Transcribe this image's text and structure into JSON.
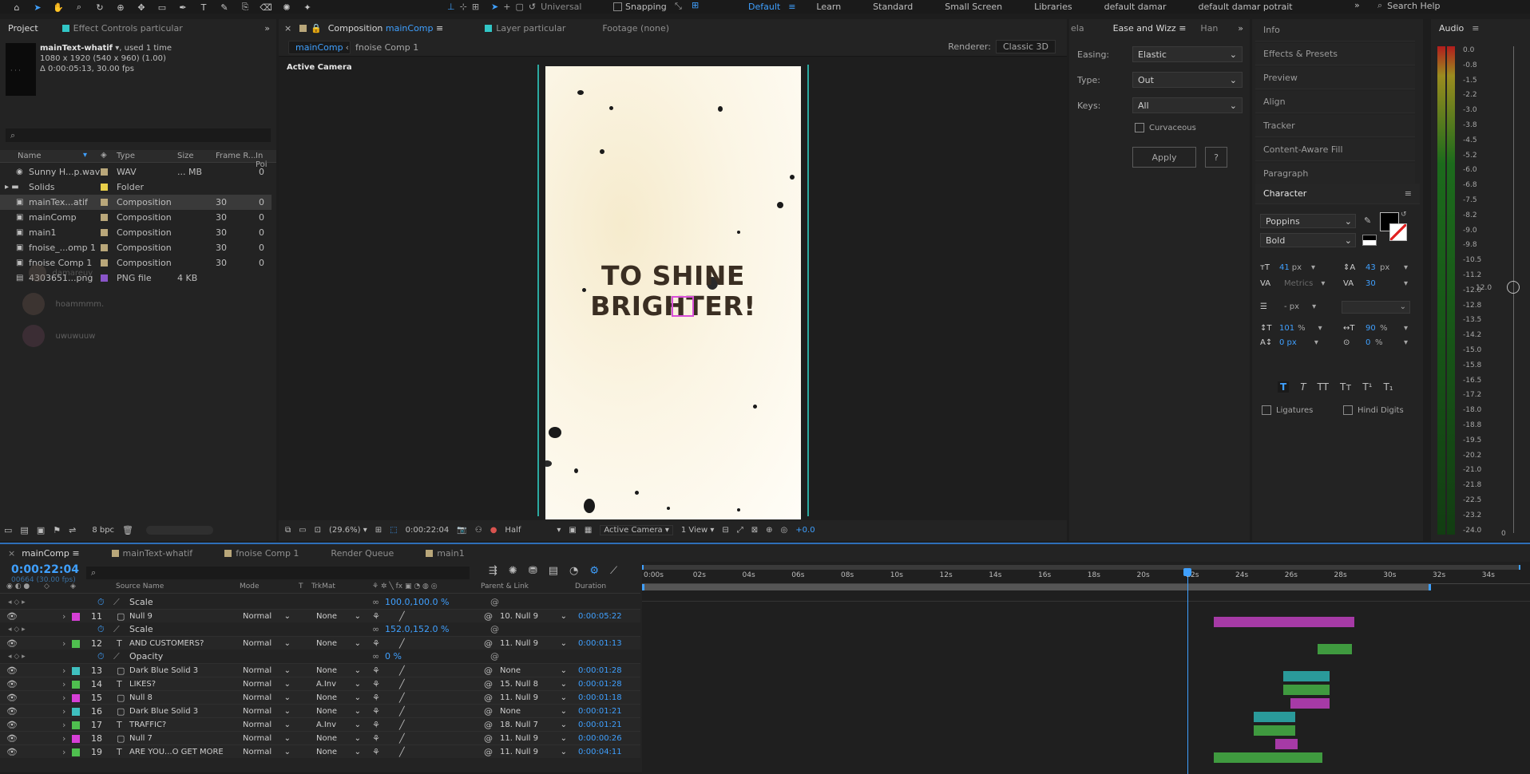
{
  "top": {
    "tools": [
      "home-icon",
      "selection-tool-icon",
      "hand-tool-icon",
      "zoom-tool-icon",
      "rotate-tool-icon",
      "camera-orbit-icon",
      "anchor-tool-icon",
      "rectangle-tool-icon",
      "pen-tool-icon",
      "type-tool-icon",
      "brush-tool-icon",
      "clone-tool-icon",
      "eraser-tool-icon",
      "roto-brush-icon",
      "puppet-tool-icon"
    ],
    "universal": "Universal",
    "snapping": "Snapping",
    "workspaces": [
      "Default",
      "Learn",
      "Standard",
      "Small Screen",
      "Libraries",
      "default damar",
      "default damar potrait"
    ],
    "search": "Search Help"
  },
  "project": {
    "tab": "Project",
    "effects_tab": "Effect Controls particular",
    "comp_name": "mainText-whatif",
    "used": ", used 1 time",
    "dims": "1080 x 1920  (540 x 960) (1.00)",
    "duration": "Δ 0:00:05:13, 30.00 fps",
    "cols": [
      "Name",
      "Type",
      "Size",
      "Frame R...",
      "In Poi"
    ],
    "items": [
      {
        "name": "Sunny H...p.wav",
        "type": "WAV",
        "size": "... MB",
        "fr": "",
        "inp": "0",
        "color": "#b9a77a"
      },
      {
        "name": "Solids",
        "type": "Folder",
        "size": "",
        "fr": "",
        "inp": "",
        "color": "#e8cf4a"
      },
      {
        "name": "mainTex...atif",
        "type": "Composition",
        "size": "",
        "fr": "30",
        "inp": "0",
        "color": "#b9a77a"
      },
      {
        "name": "mainComp",
        "type": "Composition",
        "size": "",
        "fr": "30",
        "inp": "0",
        "color": "#b9a77a"
      },
      {
        "name": "main1",
        "type": "Composition",
        "size": "",
        "fr": "30",
        "inp": "0",
        "color": "#b9a77a"
      },
      {
        "name": "fnoise_...omp 1",
        "type": "Composition",
        "size": "",
        "fr": "30",
        "inp": "0",
        "color": "#b9a77a"
      },
      {
        "name": "fnoise Comp 1",
        "type": "Composition",
        "size": "",
        "fr": "30",
        "inp": "0",
        "color": "#b9a77a"
      },
      {
        "name": "4303651...png",
        "type": "PNG file",
        "size": "4 KB",
        "fr": "",
        "inp": "",
        "color": "#8a55c9"
      }
    ],
    "ghosts": [
      "damareuy",
      "hoammmm.",
      "uwuwuuw"
    ],
    "bpc": "8 bpc"
  },
  "comp": {
    "tab": "Composition",
    "tab_name": "mainComp",
    "layer_tab": "Layer particular",
    "footage_tab": "Footage (none)",
    "crumbs": [
      "mainComp",
      "fnoise Comp 1"
    ],
    "renderer_label": "Renderer:",
    "renderer": "Classic 3D",
    "active_camera": "Active Camera",
    "text_line1": "TO SHINE",
    "text_line2": "BRIGHTER!",
    "zoom": "(29.6%)",
    "time": "0:00:22:04",
    "resolution": "Half",
    "camera": "Active Camera",
    "view": "1 View",
    "exposure": "+0.0"
  },
  "ease": {
    "tabs": [
      "ela",
      "Ease and Wizz",
      "Han"
    ],
    "easing_label": "Easing:",
    "easing": "Elastic",
    "type_label": "Type:",
    "type": "Out",
    "keys_label": "Keys:",
    "keys": "All",
    "curvaceous": "Curvaceous",
    "apply": "Apply",
    "help": "?"
  },
  "right": {
    "items": [
      "Info",
      "Effects & Presets",
      "Preview",
      "Align",
      "Tracker",
      "Content-Aware Fill",
      "Paragraph"
    ],
    "character": "Character",
    "font": "Poppins",
    "style": "Bold",
    "size": "41",
    "size_unit": "px",
    "leading": "43",
    "leading_unit": "px",
    "kerning": "Metrics",
    "tracking": "30",
    "stroke": "- px",
    "vscale": "101",
    "hscale": "90",
    "baseline": "0 px",
    "tsume": "0",
    "percent": "%",
    "ligatures": "Ligatures",
    "hindi": "Hindi Digits"
  },
  "audio": {
    "title": "Audio",
    "levels": [
      "0.0",
      "-0.8",
      "-1.5",
      "-2.2",
      "-3.0",
      "-3.8",
      "-4.5",
      "-5.2",
      "-6.0",
      "-6.8",
      "-7.5",
      "-8.2",
      "-9.0",
      "-9.8",
      "-10.5",
      "-11.2",
      "-12.0",
      "-12.8",
      "-13.5",
      "-14.2",
      "-15.0",
      "-15.8",
      "-16.5",
      "-17.2",
      "-18.0",
      "-18.8",
      "-19.5",
      "-20.2",
      "-21.0",
      "-21.8",
      "-22.5",
      "-23.2",
      "-24.0"
    ],
    "right": [
      "12.0",
      "0"
    ]
  },
  "timeline": {
    "tabs": [
      "mainComp",
      "mainText-whatif",
      "fnoise Comp 1",
      "Render Queue",
      "main1"
    ],
    "time": "0:00:22:04",
    "frames": "00664 (30.00 fps)",
    "cols": [
      "Source Name",
      "Mode",
      "T",
      "TrkMat",
      "Parent & Link",
      "Duration"
    ],
    "ruler": [
      "0:00s",
      "02s",
      "04s",
      "06s",
      "08s",
      "10s",
      "12s",
      "14s",
      "16s",
      "18s",
      "20s",
      "22s",
      "24s",
      "26s",
      "28s",
      "30s",
      "32s",
      "34s"
    ],
    "rows": [
      {
        "kind": "prop",
        "name": "Scale",
        "value": "100.0,100.0 %"
      },
      {
        "kind": "layer",
        "num": "11",
        "name": "Null 9",
        "mode": "Normal",
        "trk": "None",
        "parent": "10. Null 9",
        "dur": "0:00:05:22",
        "color": "#d63fd6",
        "icon": "solid"
      },
      {
        "kind": "prop",
        "name": "Scale",
        "value": "152.0,152.0 %"
      },
      {
        "kind": "layer",
        "num": "12",
        "name": "AND CUSTOMERS?",
        "mode": "Normal",
        "trk": "None",
        "parent": "11. Null 9",
        "dur": "0:00:01:13",
        "color": "#4fbf4f",
        "icon": "T"
      },
      {
        "kind": "prop",
        "name": "Opacity",
        "value": "0 %"
      },
      {
        "kind": "layer",
        "num": "13",
        "name": "Dark Blue Solid 3",
        "mode": "Normal",
        "trk": "None",
        "parent": "None",
        "dur": "0:00:01:28",
        "color": "#3fbfbf",
        "icon": "solid"
      },
      {
        "kind": "layer",
        "num": "14",
        "name": "LIKES?",
        "mode": "Normal",
        "trk": "A.Inv",
        "parent": "15. Null 8",
        "dur": "0:00:01:28",
        "color": "#4fbf4f",
        "icon": "T"
      },
      {
        "kind": "layer",
        "num": "15",
        "name": "Null 8",
        "mode": "Normal",
        "trk": "None",
        "parent": "11. Null 9",
        "dur": "0:00:01:18",
        "color": "#d63fd6",
        "icon": "solid"
      },
      {
        "kind": "layer",
        "num": "16",
        "name": "Dark Blue Solid 3",
        "mode": "Normal",
        "trk": "None",
        "parent": "None",
        "dur": "0:00:01:21",
        "color": "#3fbfbf",
        "icon": "solid"
      },
      {
        "kind": "layer",
        "num": "17",
        "name": "TRAFFIC?",
        "mode": "Normal",
        "trk": "A.Inv",
        "parent": "18. Null 7",
        "dur": "0:00:01:21",
        "color": "#4fbf4f",
        "icon": "T"
      },
      {
        "kind": "layer",
        "num": "18",
        "name": "Null 7",
        "mode": "Normal",
        "trk": "None",
        "parent": "11. Null 9",
        "dur": "0:00:00:26",
        "color": "#d63fd6",
        "icon": "solid"
      },
      {
        "kind": "layer",
        "num": "19",
        "name": "ARE YOU...O GET MORE",
        "mode": "Normal",
        "trk": "None",
        "parent": "11. Null 9",
        "dur": "0:00:04:11",
        "color": "#4fbf4f",
        "icon": "T"
      }
    ],
    "bars": [
      {
        "row": 1,
        "start": 23.2,
        "end": 28.9,
        "color": "#a63aa6"
      },
      {
        "row": 3,
        "start": 27.4,
        "end": 28.8,
        "color": "#3f9a3f"
      },
      {
        "row": 5,
        "start": 26.0,
        "end": 27.9,
        "color": "#2a9a9a"
      },
      {
        "row": 6,
        "start": 26.0,
        "end": 27.9,
        "color": "#3f9a3f"
      },
      {
        "row": 7,
        "start": 26.3,
        "end": 27.9,
        "color": "#a63aa6"
      },
      {
        "row": 8,
        "start": 24.8,
        "end": 26.5,
        "color": "#2a9a9a"
      },
      {
        "row": 9,
        "start": 24.8,
        "end": 26.5,
        "color": "#3f9a3f"
      },
      {
        "row": 10,
        "start": 25.7,
        "end": 26.6,
        "color": "#a63aa6"
      },
      {
        "row": 11,
        "start": 23.2,
        "end": 27.6,
        "color": "#3f9a3f"
      }
    ],
    "playhead_s": 22.13
  }
}
